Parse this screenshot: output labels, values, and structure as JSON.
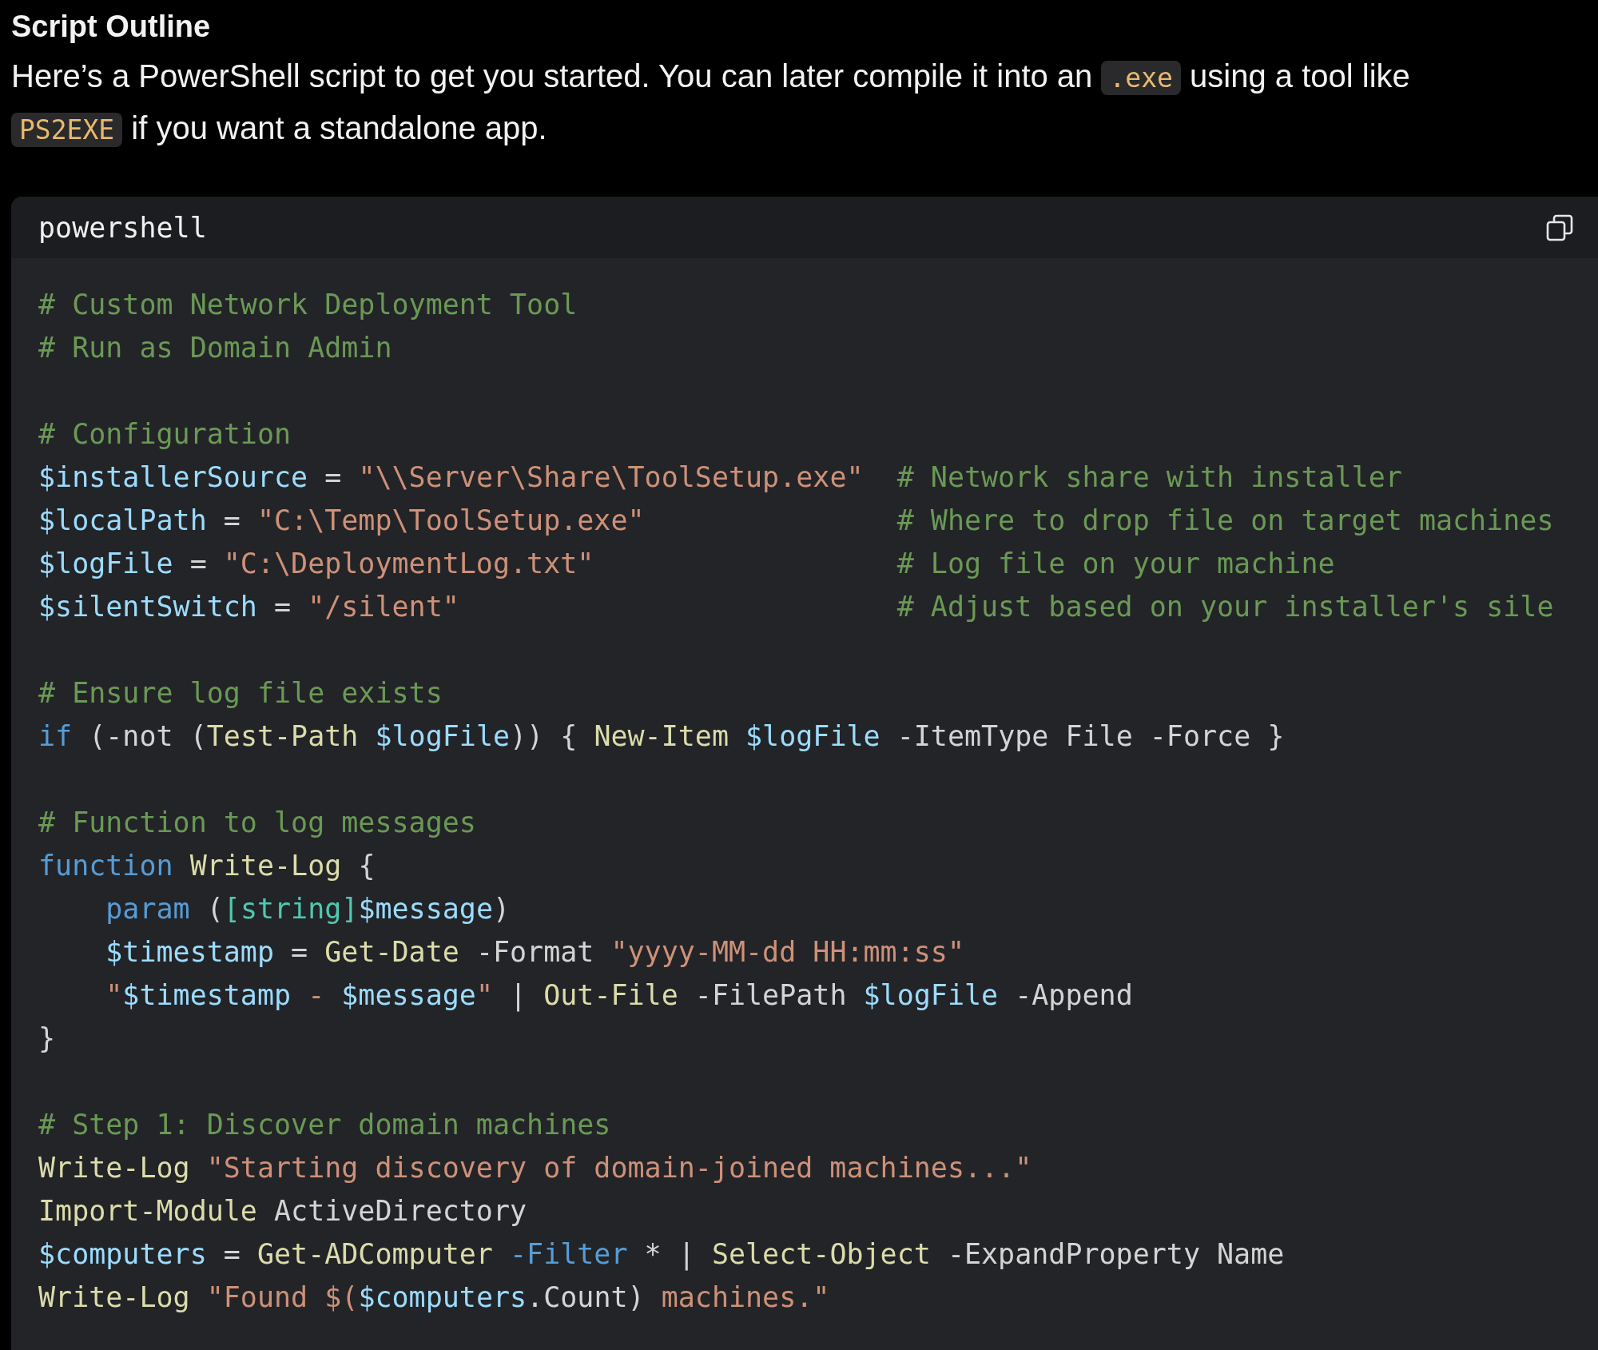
{
  "heading": "Script Outline",
  "intro": [
    {
      "kind": "text",
      "text": "Here’s a PowerShell script to get you started. You can later compile it into an "
    },
    {
      "kind": "code",
      "text": ".exe"
    },
    {
      "kind": "text",
      "text": " using a tool like "
    },
    {
      "kind": "code",
      "text": "PS2EXE"
    },
    {
      "kind": "text",
      "text": " if you want a standalone app."
    }
  ],
  "code_block": {
    "language": "powershell",
    "blocks": [
      [
        [
          {
            "kind": "comment",
            "text": "# Custom Network Deployment Tool"
          }
        ],
        [
          {
            "kind": "comment",
            "text": "# Run as Domain Admin"
          }
        ]
      ],
      [
        [
          {
            "kind": "comment",
            "text": "# Configuration"
          }
        ],
        [
          {
            "kind": "variable",
            "text": "$installerSource"
          },
          {
            "kind": "plain",
            "text": " = "
          },
          {
            "kind": "string",
            "text": "\"\\\\Server\\Share\\ToolSetup.exe\"  "
          },
          {
            "kind": "comment",
            "text": "# Network share with installer"
          }
        ],
        [
          {
            "kind": "variable",
            "text": "$localPath"
          },
          {
            "kind": "plain",
            "text": " = "
          },
          {
            "kind": "string",
            "text": "\"C:\\Temp\\ToolSetup.exe\"               "
          },
          {
            "kind": "comment",
            "text": "# Where to drop file on target machines"
          }
        ],
        [
          {
            "kind": "variable",
            "text": "$logFile"
          },
          {
            "kind": "plain",
            "text": " = "
          },
          {
            "kind": "string",
            "text": "\"C:\\DeploymentLog.txt\"                  "
          },
          {
            "kind": "comment",
            "text": "# Log file on your machine"
          }
        ],
        [
          {
            "kind": "variable",
            "text": "$silentSwitch"
          },
          {
            "kind": "plain",
            "text": " = "
          },
          {
            "kind": "string",
            "text": "\"/silent\"                          "
          },
          {
            "kind": "comment",
            "text": "# Adjust based on your installer's sile"
          }
        ]
      ],
      [
        [
          {
            "kind": "comment",
            "text": "# Ensure log file exists"
          }
        ],
        [
          {
            "kind": "keyword",
            "text": "if"
          },
          {
            "kind": "plain",
            "text": " (-not ("
          },
          {
            "kind": "command",
            "text": "Test-Path "
          },
          {
            "kind": "variable",
            "text": "$logFile"
          },
          {
            "kind": "plain",
            "text": ")) { "
          },
          {
            "kind": "command",
            "text": "New-Item "
          },
          {
            "kind": "variable",
            "text": "$logFile"
          },
          {
            "kind": "plain",
            "text": " -ItemType File -Force }"
          }
        ]
      ],
      [
        [
          {
            "kind": "comment",
            "text": "# Function to log messages"
          }
        ],
        [
          {
            "kind": "keyword",
            "text": "function "
          },
          {
            "kind": "command",
            "text": "Write-Log"
          },
          {
            "kind": "plain",
            "text": " {"
          }
        ],
        [
          {
            "kind": "keyword",
            "text": "    param"
          },
          {
            "kind": "plain",
            "text": " ("
          },
          {
            "kind": "type",
            "text": "[string]"
          },
          {
            "kind": "variable",
            "text": "$message"
          },
          {
            "kind": "plain",
            "text": ")"
          }
        ],
        [
          {
            "kind": "variable",
            "text": "    $timestamp"
          },
          {
            "kind": "plain",
            "text": " = "
          },
          {
            "kind": "command",
            "text": "Get-Date"
          },
          {
            "kind": "plain",
            "text": " -Format "
          },
          {
            "kind": "string",
            "text": "\"yyyy-MM-dd HH:mm:ss\""
          }
        ],
        [
          {
            "kind": "string",
            "text": "    \""
          },
          {
            "kind": "variable",
            "text": "$timestamp"
          },
          {
            "kind": "string",
            "text": " - "
          },
          {
            "kind": "variable",
            "text": "$message"
          },
          {
            "kind": "string",
            "text": "\""
          },
          {
            "kind": "plain",
            "text": " | "
          },
          {
            "kind": "command",
            "text": "Out-File"
          },
          {
            "kind": "plain",
            "text": " -FilePath "
          },
          {
            "kind": "variable",
            "text": "$logFile"
          },
          {
            "kind": "plain",
            "text": " -Append"
          }
        ],
        [
          {
            "kind": "plain",
            "text": "}"
          }
        ]
      ],
      [
        [
          {
            "kind": "comment",
            "text": "# Step 1: Discover domain machines"
          }
        ],
        [
          {
            "kind": "command",
            "text": "Write-Log "
          },
          {
            "kind": "string",
            "text": "\"Starting discovery of domain-joined machines...\""
          }
        ],
        [
          {
            "kind": "command",
            "text": "Import-Module"
          },
          {
            "kind": "plain",
            "text": " ActiveDirectory"
          }
        ],
        [
          {
            "kind": "variable",
            "text": "$computers"
          },
          {
            "kind": "plain",
            "text": " = "
          },
          {
            "kind": "command",
            "text": "Get-ADComputer "
          },
          {
            "kind": "keyword",
            "text": "-Filter"
          },
          {
            "kind": "plain",
            "text": " * | "
          },
          {
            "kind": "command",
            "text": "Select-Object"
          },
          {
            "kind": "plain",
            "text": " -ExpandProperty Name"
          }
        ],
        [
          {
            "kind": "command",
            "text": "Write-Log "
          },
          {
            "kind": "string",
            "text": "\"Found $("
          },
          {
            "kind": "variable",
            "text": "$computers"
          },
          {
            "kind": "plain",
            "text": ".Count)"
          },
          {
            "kind": "string",
            "text": " machines.\""
          }
        ]
      ]
    ]
  }
}
